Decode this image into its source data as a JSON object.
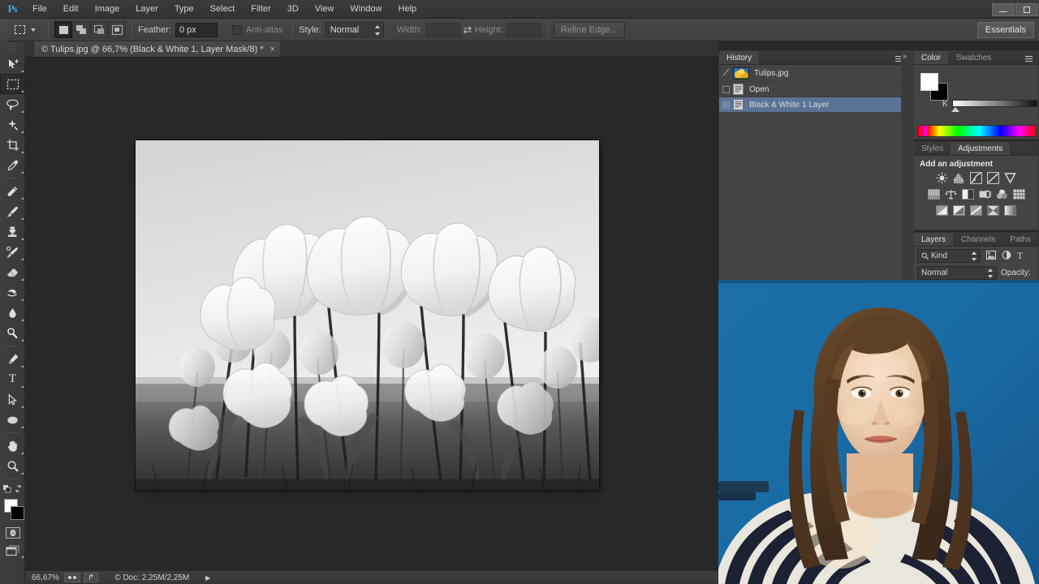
{
  "app": {
    "name": "Adobe Photoshop",
    "logo": "Ps"
  },
  "menubar": {
    "items": [
      "File",
      "Edit",
      "Image",
      "Layer",
      "Type",
      "Select",
      "Filter",
      "3D",
      "View",
      "Window",
      "Help"
    ]
  },
  "window_controls": {
    "minimize": "minimize-icon",
    "maximize": "maximize-icon",
    "close": "close-icon"
  },
  "options_bar": {
    "tool_icon": "rectangular-marquee-icon",
    "selection_modes": [
      "new-selection",
      "add-to-selection",
      "subtract-from-selection",
      "intersect-with-selection"
    ],
    "feather_label": "Feather:",
    "feather_value": "0 px",
    "antialias_label": "Anti-alias",
    "antialias_checked": false,
    "style_label": "Style:",
    "style_value": "Normal",
    "width_label": "Width:",
    "width_value": "",
    "height_label": "Height:",
    "height_value": "",
    "swap_icon": "swap-width-height-icon",
    "refine_edge_label": "Refine Edge...",
    "workspace_label": "Essentials"
  },
  "toolbar": {
    "tools": [
      {
        "name": "move-tool",
        "selected": false
      },
      {
        "name": "rectangular-marquee-tool",
        "selected": true
      },
      {
        "name": "lasso-tool",
        "selected": false
      },
      {
        "name": "quick-selection-tool",
        "selected": false
      },
      {
        "name": "crop-tool",
        "selected": false
      },
      {
        "name": "eyedropper-tool",
        "selected": false
      },
      {
        "name": "spot-healing-brush-tool",
        "selected": false
      },
      {
        "name": "brush-tool",
        "selected": false
      },
      {
        "name": "clone-stamp-tool",
        "selected": false
      },
      {
        "name": "history-brush-tool",
        "selected": false
      },
      {
        "name": "eraser-tool",
        "selected": false
      },
      {
        "name": "gradient-tool",
        "selected": false
      },
      {
        "name": "blur-tool",
        "selected": false
      },
      {
        "name": "dodge-tool",
        "selected": false
      },
      {
        "name": "pen-tool",
        "selected": false
      },
      {
        "name": "type-tool",
        "selected": false
      },
      {
        "name": "path-selection-tool",
        "selected": false
      },
      {
        "name": "ellipse-shape-tool",
        "selected": false
      },
      {
        "name": "hand-tool",
        "selected": false
      },
      {
        "name": "zoom-tool",
        "selected": false
      }
    ],
    "type_tool_glyph": "T",
    "foreground_color": "#ffffff",
    "background_color": "#000000",
    "quick_mask": "edit-in-quick-mask-mode",
    "screen_mode": "change-screen-mode"
  },
  "document": {
    "tab_title": "© Tulips.jpg @ 66,7% (Black & White 1, Layer Mask/8) *",
    "close_glyph": "×",
    "image_description": "black-and-white-tulips-photo"
  },
  "status_bar": {
    "zoom": "66,67%",
    "doc_info": "© Doc: 2,25M/2,25M",
    "arrow_glyph": "▶"
  },
  "history_panel": {
    "tabs": [
      {
        "label": "History",
        "active": true
      }
    ],
    "menu_icon": "panel-menu-icon",
    "snapshot": {
      "label": "Tulips.jpg",
      "icon": "history-brush-source-icon",
      "thumb": "tulips-thumbnail"
    },
    "states": [
      {
        "label": "Open",
        "selected": false
      },
      {
        "label": "Black & White 1 Layer",
        "selected": true
      }
    ]
  },
  "color_panel": {
    "tabs": [
      {
        "label": "Color",
        "active": true
      },
      {
        "label": "Swatches",
        "active": false
      }
    ],
    "menu_icon": "panel-menu-icon",
    "channel_label": "K",
    "foreground": "#ffffff",
    "background": "#000000"
  },
  "adjustments_panel": {
    "tabs": [
      {
        "label": "Styles",
        "active": false
      },
      {
        "label": "Adjustments",
        "active": true
      }
    ],
    "title": "Add an adjustment",
    "icons": [
      [
        "brightness-contrast-icon",
        "levels-icon",
        "curves-icon",
        "exposure-icon",
        "vibrance-icon"
      ],
      [
        "hue-saturation-icon",
        "color-balance-icon",
        "black-and-white-icon",
        "photo-filter-icon",
        "channel-mixer-icon",
        "color-lookup-icon"
      ],
      [
        "invert-icon",
        "posterize-icon",
        "threshold-icon",
        "selective-color-icon",
        "gradient-map-icon"
      ]
    ]
  },
  "layers_panel": {
    "tabs": [
      {
        "label": "Layers",
        "active": true
      },
      {
        "label": "Channels",
        "active": false
      },
      {
        "label": "Paths",
        "active": false
      }
    ],
    "filter_label": "Kind",
    "filter_icons": [
      "filter-pixel-icon",
      "filter-adjustment-icon",
      "filter-type-icon"
    ],
    "blend_mode": "Normal",
    "opacity_label": "Opacity:"
  },
  "webcam": {
    "description": "webcam-overlay-person-blue-background"
  },
  "colors": {
    "panel_bg": "#444444",
    "canvas_bg": "#282828",
    "chrome_bg": "#3f3f3f",
    "selection_blue": "#5a7396",
    "accent": "#4ba3d8"
  }
}
